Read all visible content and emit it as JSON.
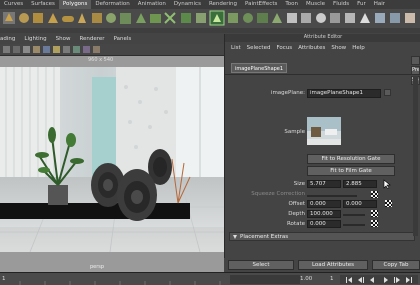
{
  "shelf_tabs": [
    {
      "label": "Curves",
      "active": false
    },
    {
      "label": "Surfaces",
      "active": false
    },
    {
      "label": "Polygons",
      "active": true
    },
    {
      "label": "Deformation",
      "active": false
    },
    {
      "label": "Animation",
      "active": false
    },
    {
      "label": "Dynamics",
      "active": false
    },
    {
      "label": "Rendering",
      "active": false
    },
    {
      "label": "PaintEffects",
      "active": false
    },
    {
      "label": "Toon",
      "active": false
    },
    {
      "label": "Muscle",
      "active": false
    },
    {
      "label": "Fluids",
      "active": false
    },
    {
      "label": "Fur",
      "active": false
    },
    {
      "label": "Hair",
      "active": false
    }
  ],
  "panel_menu": [
    "ading",
    "Lighting",
    "Show",
    "Renderer",
    "Panels"
  ],
  "viewport": {
    "resolution": "960 x 540",
    "camera": "persp"
  },
  "attribute_editor": {
    "title": "Attribute Editor",
    "menu": [
      "List",
      "Selected",
      "Focus",
      "Attributes",
      "Show",
      "Help"
    ],
    "node_tab": "imagePlaneShape1",
    "image_plane_label": "imagePlane:",
    "image_plane_value": "imagePlaneShape1",
    "side_buttons": [
      "",
      "Pre",
      "Show"
    ],
    "sample_label": "Sample",
    "fit_resolution_gate": "Fit to Resolution Gate",
    "fit_film_gate": "Fit to Film Gate",
    "size_label": "Size",
    "size_x": "5.707",
    "size_y": "2.885",
    "squeeze_label": "Squeeze Correction",
    "offset_label": "Offset",
    "offset_x": "0.000",
    "offset_y": "0.000",
    "depth_label": "Depth",
    "depth_value": "100.000",
    "rotate_label": "Rotate",
    "rotate_value": "0.000",
    "placement_extras": "Placement Extras",
    "buttons": {
      "select": "Select",
      "load_attributes": "Load Attributes",
      "copy_tab": "Copy Tab"
    }
  },
  "timeline": {
    "value_1": "1",
    "value_2": "1.00",
    "value_3": "1"
  }
}
